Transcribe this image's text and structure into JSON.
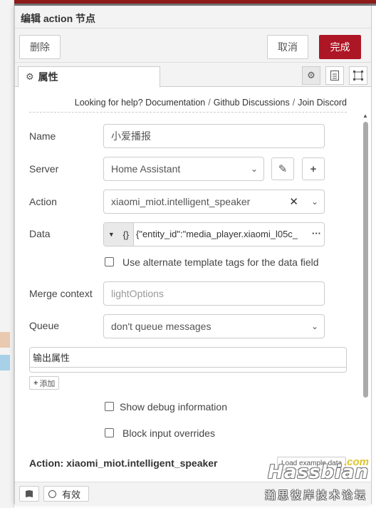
{
  "header": {
    "title": "编辑 action 节点"
  },
  "toolbar": {
    "delete_label": "删除",
    "cancel_label": "取消",
    "done_label": "完成"
  },
  "tabs": {
    "properties_label": "属性",
    "icons": [
      "gear-icon",
      "description-icon",
      "appearance-icon"
    ]
  },
  "help": {
    "prefix": "Looking for help?",
    "links": [
      "Documentation",
      "Github Discussions",
      "Join Discord"
    ]
  },
  "form": {
    "name_label": "Name",
    "name_value": "小爱播报",
    "server_label": "Server",
    "server_value": "Home Assistant",
    "action_label": "Action",
    "action_value": "xiaomi_miot.intelligent_speaker",
    "data_label": "Data",
    "data_value": "{\"entity_id\":\"media_player.xiaomi_l05c_",
    "data_type_icon": "{}",
    "alt_template_label": "Use alternate template tags for the data field",
    "merge_label": "Merge context",
    "merge_placeholder": "lightOptions",
    "queue_label": "Queue",
    "queue_value": "don't queue messages",
    "output_label": "输出属性",
    "add_label": "添加",
    "debug_label": "Show debug information",
    "block_label": "Block input overrides"
  },
  "action_info": {
    "heading": "Action: xiaomi_miot.intelligent_speaker",
    "load_example_label": "Load example data"
  },
  "footer": {
    "enabled_label": "有效"
  },
  "watermark": {
    "logo": "Hassbian",
    "com": ".com",
    "subtitle": "瀚思彼岸技术论坛"
  },
  "colors": {
    "primary": "#ad1625",
    "accent_bar": "#8f1b1b"
  }
}
